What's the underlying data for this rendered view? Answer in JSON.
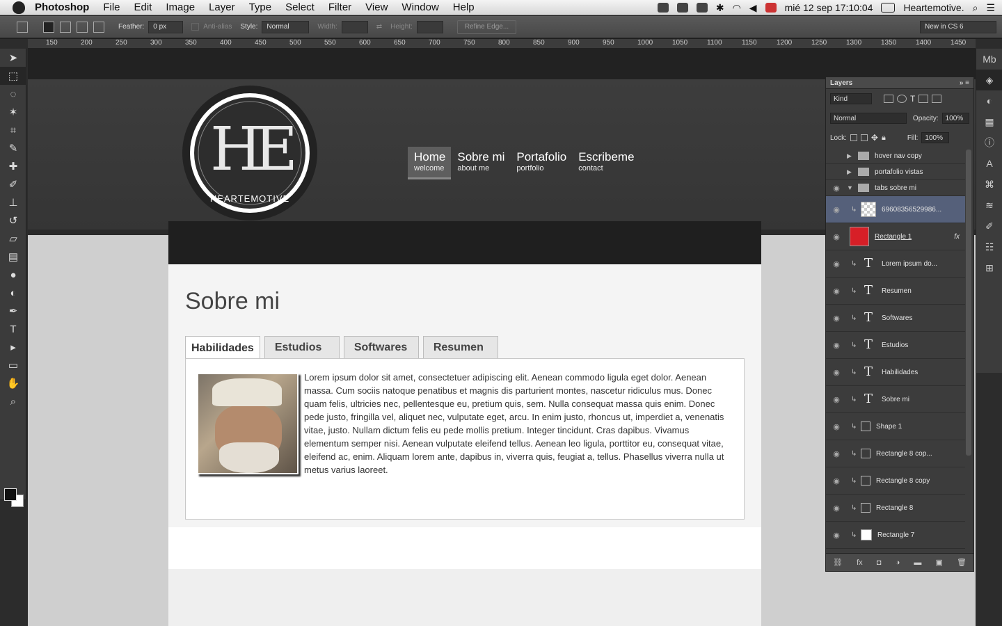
{
  "menubar": {
    "app_name": "Photoshop",
    "items": [
      "File",
      "Edit",
      "Image",
      "Layer",
      "Type",
      "Select",
      "Filter",
      "View",
      "Window",
      "Help"
    ],
    "datetime": "mié 12 sep  17:10:04",
    "user": "Heartemotive."
  },
  "options": {
    "feather_label": "Feather:",
    "feather_value": "0 px",
    "antialias_label": "Anti-alias",
    "style_label": "Style:",
    "style_value": "Normal",
    "width_label": "Width:",
    "height_label": "Height:",
    "refine_label": "Refine Edge...",
    "workspace": "New in CS 6"
  },
  "ruler": {
    "ticks": [
      "150",
      "200",
      "250",
      "300",
      "350",
      "400",
      "450",
      "500",
      "550",
      "600",
      "650",
      "700",
      "750",
      "800",
      "850",
      "900",
      "950",
      "1000",
      "1050",
      "1100",
      "1150",
      "1200",
      "1250",
      "1300",
      "1350",
      "1400",
      "1450"
    ]
  },
  "site": {
    "logo_text": "HEARTEMOTIVE",
    "nav": [
      {
        "label": "Home",
        "sub": "welcome"
      },
      {
        "label": "Sobre mi",
        "sub": "about me"
      },
      {
        "label": "Portafolio",
        "sub": "portfolio"
      },
      {
        "label": "Escribeme",
        "sub": "contact"
      }
    ],
    "title": "Sobre mi",
    "tabs": [
      "Habilidades",
      "Estudios",
      "Softwares",
      "Resumen"
    ],
    "lorem": "Lorem ipsum dolor sit amet, consectetuer adipiscing elit. Aenean commodo ligula eget dolor. Aenean massa. Cum sociis natoque penatibus et magnis dis parturient montes, nascetur ridiculus mus. Donec quam felis, ultricies nec, pellentesque eu, pretium quis, sem. Nulla consequat massa quis enim. Donec pede justo, fringilla vel, aliquet nec, vulputate eget, arcu. In enim justo, rhoncus ut, imperdiet a, venenatis vitae, justo. Nullam dictum felis eu pede mollis pretium. Integer tincidunt. Cras dapibus. Vivamus elementum semper nisi. Aenean vulputate eleifend tellus. Aenean leo ligula, porttitor eu, consequat vitae, eleifend ac, enim. Aliquam lorem ante, dapibus in, viverra quis, feugiat a, tellus. Phasellus viverra nulla ut metus varius laoreet."
  },
  "layers_panel": {
    "title": "Layers",
    "kind": "Kind",
    "blend": "Normal",
    "opacity_label": "Opacity:",
    "opacity": "100%",
    "lock_label": "Lock:",
    "fill_label": "Fill:",
    "fill": "100%",
    "layers": [
      {
        "name": "hover nav copy"
      },
      {
        "name": "portafolio vistas"
      },
      {
        "name": "tabs sobre mi"
      },
      {
        "name": "69608356529986..."
      },
      {
        "name": "Rectangle 1"
      },
      {
        "name": "Lorem ipsum do..."
      },
      {
        "name": "Resumen"
      },
      {
        "name": "Softwares"
      },
      {
        "name": "Estudios"
      },
      {
        "name": "Habilidades"
      },
      {
        "name": "Sobre mi"
      },
      {
        "name": "Shape 1"
      },
      {
        "name": "Rectangle 8 cop..."
      },
      {
        "name": "Rectangle 8 copy"
      },
      {
        "name": "Rectangle 8"
      },
      {
        "name": "Rectangle 7"
      }
    ]
  },
  "colors": {
    "accent_red": "#d71f27",
    "selection": "#55607a"
  }
}
